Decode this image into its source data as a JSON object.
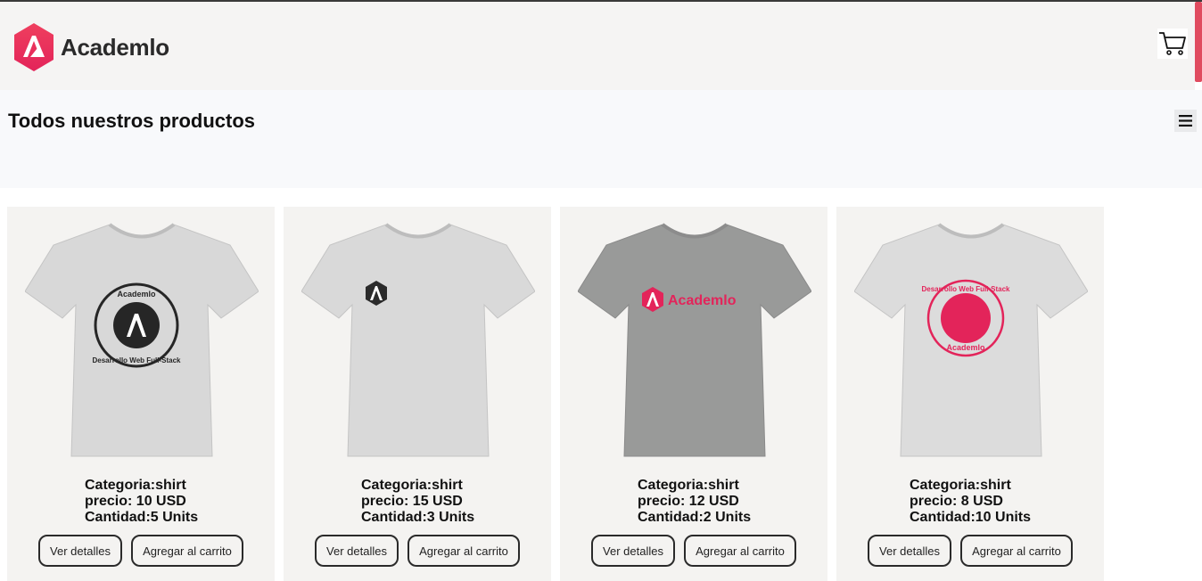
{
  "navbar": {
    "brand_name": "Academlo",
    "logo_icon": "academlo-logo-icon",
    "cart_icon": "shopping-cart-icon"
  },
  "page": {
    "title": "Todos nuestros productos",
    "menu_icon": "hamburger-menu-icon"
  },
  "colors": {
    "brand": "#e3245a",
    "navbar_bg": "#f5f4f3",
    "card_bg": "#f4f3f1",
    "scroll_accent": "#e04b5f"
  },
  "products": [
    {
      "shirt_color": "#d8d8d8",
      "print": "black circular badge",
      "print_text_top": "Academlo",
      "print_text_bottom": "Desarrollo Web Full-Stack",
      "category": "Categoria:shirt",
      "price": "precio: 10 USD",
      "quantity": "Cantidad:5 Units",
      "detail_label": "Ver detalles",
      "cart_label": "Agregar al carrito"
    },
    {
      "shirt_color": "#d9d9d9",
      "print": "small black hexagon logo",
      "category": "Categoria:shirt",
      "price": "precio: 15 USD",
      "quantity": "Cantidad:3 Units",
      "detail_label": "Ver detalles",
      "cart_label": "Agregar al carrito"
    },
    {
      "shirt_color": "#999a99",
      "print": "pink wordmark",
      "print_text": "Academlo",
      "category": "Categoria:shirt",
      "price": "precio: 12 USD",
      "quantity": "Cantidad:2 Units",
      "detail_label": "Ver detalles",
      "cart_label": "Agregar al carrito"
    },
    {
      "shirt_color": "#dcdcdc",
      "print": "pink circular badge",
      "print_text_top": "Desarrollo Web Full-Stack",
      "print_text_bottom": "Academlo",
      "category": "Categoria:shirt",
      "price": "precio: 8 USD",
      "quantity": "Cantidad:10 Units",
      "detail_label": "Ver detalles",
      "cart_label": "Agregar al carrito"
    }
  ]
}
